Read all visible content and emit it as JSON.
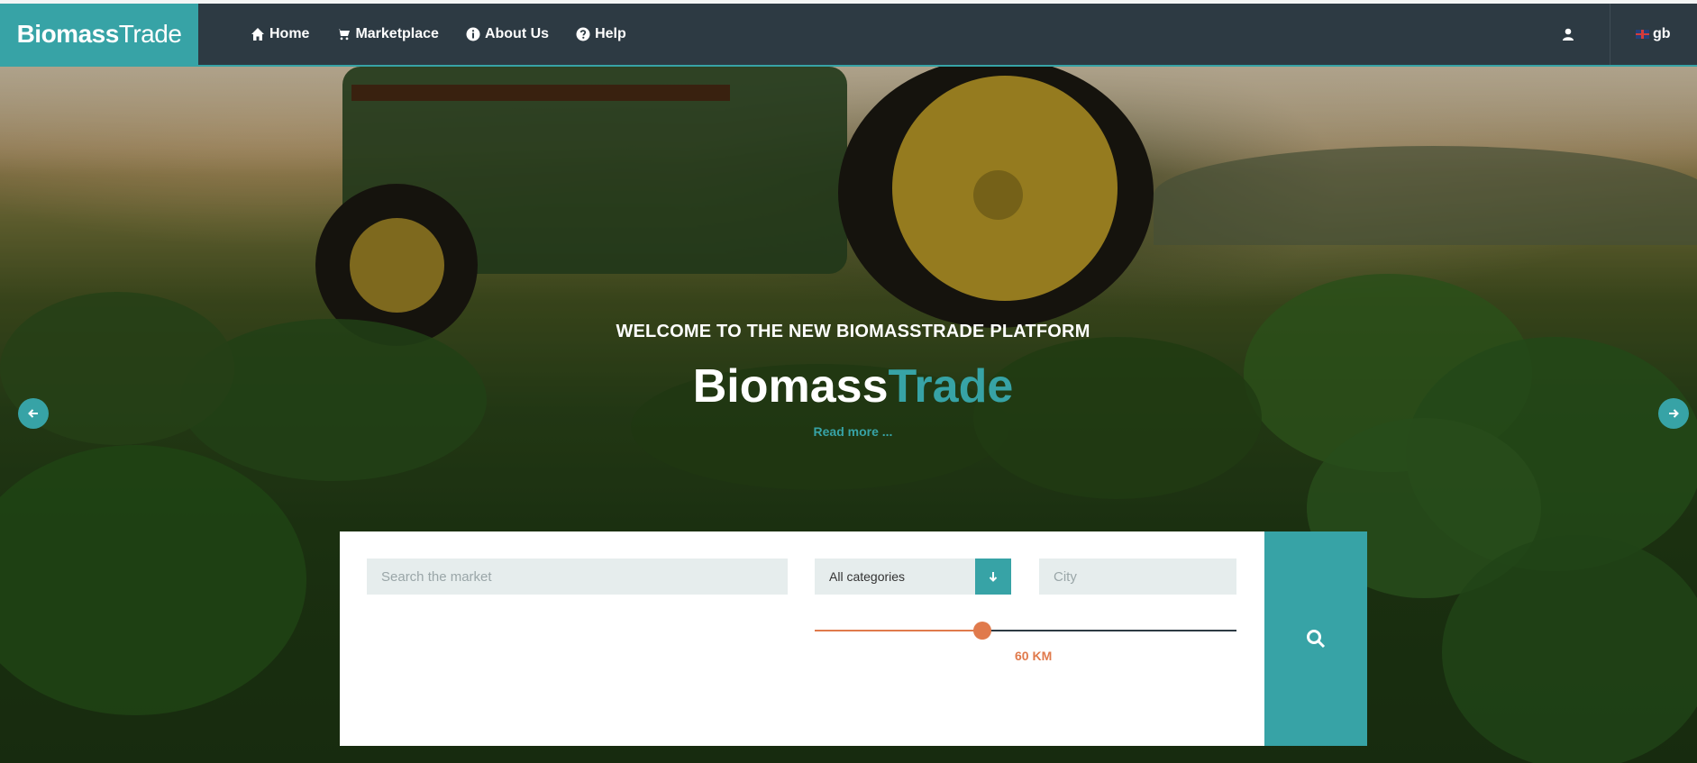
{
  "brand": {
    "bold": "Biomass",
    "thin": "Trade"
  },
  "nav": {
    "items": [
      {
        "label": "Home",
        "icon": "home-icon"
      },
      {
        "label": "Marketplace",
        "icon": "cart-icon"
      },
      {
        "label": "About Us",
        "icon": "info-icon"
      },
      {
        "label": "Help",
        "icon": "help-icon"
      }
    ],
    "user_icon": "user-icon",
    "language": "gb"
  },
  "hero": {
    "subtitle": "WELCOME TO THE NEW BIOMASSTRADE PLATFORM",
    "title_part1": "Biomass",
    "title_part2": "Trade",
    "read_more": "Read more ..."
  },
  "search": {
    "search_placeholder": "Search the market",
    "category_selected": "All categories",
    "city_placeholder": "City",
    "radius_value": 60,
    "radius_unit": "KM",
    "radius_label": "60 KM"
  },
  "colors": {
    "accent": "#37a3a6",
    "navbar": "#2d3a43",
    "slider": "#e07a4c"
  }
}
